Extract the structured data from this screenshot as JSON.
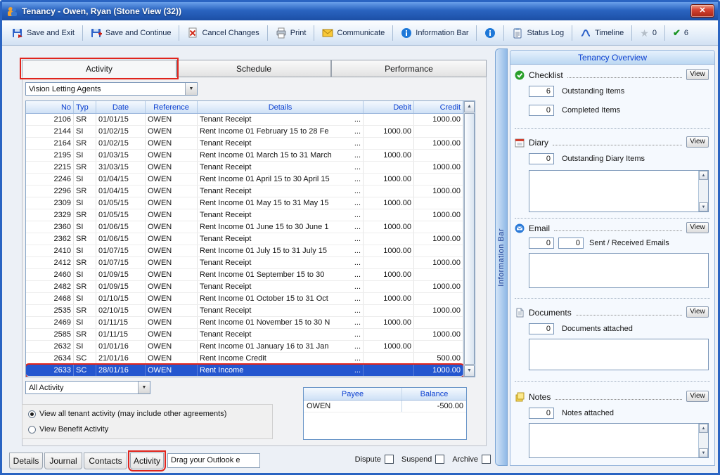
{
  "window": {
    "title": "Tenancy - Owen, Ryan (Stone View (32))"
  },
  "colors": {
    "annotation_red": "#e0241c",
    "selection_blue": "#2456cf",
    "header_text_blue": "#0a3fd0",
    "titlebar_blue": "#2a64c0"
  },
  "icons": {
    "close": "✕",
    "star": "★",
    "check": "✔",
    "combo_arrow": "▼",
    "scroll_up": "▲",
    "scroll_down": "▼"
  },
  "toolbar": {
    "save_exit": "Save and Exit",
    "save_continue": "Save and Continue",
    "cancel_changes": "Cancel Changes",
    "print": "Print",
    "communicate": "Communicate",
    "information_bar": "Information Bar",
    "status_log": "Status Log",
    "timeline": "Timeline",
    "star_count": "0",
    "check_count": "6"
  },
  "tabs": {
    "activity": "Activity",
    "schedule": "Schedule",
    "performance": "Performance"
  },
  "agent_dropdown": {
    "value": "Vision Letting Agents"
  },
  "activity_table": {
    "headers": [
      "No",
      "Typ",
      "Date",
      "Reference",
      "Details",
      "Debit",
      "Credit"
    ],
    "rows": [
      {
        "no": "2106",
        "typ": "SR",
        "date": "01/01/15",
        "ref": "OWEN",
        "details": "Tenant Receipt",
        "debit": "",
        "credit": "1000.00"
      },
      {
        "no": "2144",
        "typ": "SI",
        "date": "01/02/15",
        "ref": "OWEN",
        "details": "Rent Income 01 February 15 to 28 Fe",
        "debit": "1000.00",
        "credit": ""
      },
      {
        "no": "2164",
        "typ": "SR",
        "date": "01/02/15",
        "ref": "OWEN",
        "details": "Tenant Receipt",
        "debit": "",
        "credit": "1000.00"
      },
      {
        "no": "2195",
        "typ": "SI",
        "date": "01/03/15",
        "ref": "OWEN",
        "details": "Rent Income 01 March 15 to 31 March",
        "debit": "1000.00",
        "credit": ""
      },
      {
        "no": "2215",
        "typ": "SR",
        "date": "31/03/15",
        "ref": "OWEN",
        "details": "Tenant Receipt",
        "debit": "",
        "credit": "1000.00"
      },
      {
        "no": "2246",
        "typ": "SI",
        "date": "01/04/15",
        "ref": "OWEN",
        "details": "Rent Income 01 April 15 to 30 April 15",
        "debit": "1000.00",
        "credit": ""
      },
      {
        "no": "2296",
        "typ": "SR",
        "date": "01/04/15",
        "ref": "OWEN",
        "details": "Tenant Receipt",
        "debit": "",
        "credit": "1000.00"
      },
      {
        "no": "2309",
        "typ": "SI",
        "date": "01/05/15",
        "ref": "OWEN",
        "details": "Rent Income 01 May 15 to 31 May 15",
        "debit": "1000.00",
        "credit": ""
      },
      {
        "no": "2329",
        "typ": "SR",
        "date": "01/05/15",
        "ref": "OWEN",
        "details": "Tenant Receipt",
        "debit": "",
        "credit": "1000.00"
      },
      {
        "no": "2360",
        "typ": "SI",
        "date": "01/06/15",
        "ref": "OWEN",
        "details": "Rent Income 01 June 15 to 30 June 1",
        "debit": "1000.00",
        "credit": ""
      },
      {
        "no": "2362",
        "typ": "SR",
        "date": "01/06/15",
        "ref": "OWEN",
        "details": "Tenant Receipt",
        "debit": "",
        "credit": "1000.00"
      },
      {
        "no": "2410",
        "typ": "SI",
        "date": "01/07/15",
        "ref": "OWEN",
        "details": "Rent Income 01 July 15 to 31 July 15",
        "debit": "1000.00",
        "credit": ""
      },
      {
        "no": "2412",
        "typ": "SR",
        "date": "01/07/15",
        "ref": "OWEN",
        "details": "Tenant Receipt",
        "debit": "",
        "credit": "1000.00"
      },
      {
        "no": "2460",
        "typ": "SI",
        "date": "01/09/15",
        "ref": "OWEN",
        "details": "Rent Income 01 September 15 to 30",
        "debit": "1000.00",
        "credit": ""
      },
      {
        "no": "2482",
        "typ": "SR",
        "date": "01/09/15",
        "ref": "OWEN",
        "details": "Tenant Receipt",
        "debit": "",
        "credit": "1000.00"
      },
      {
        "no": "2468",
        "typ": "SI",
        "date": "01/10/15",
        "ref": "OWEN",
        "details": "Rent Income 01 October 15 to 31 Oct",
        "debit": "1000.00",
        "credit": ""
      },
      {
        "no": "2535",
        "typ": "SR",
        "date": "02/10/15",
        "ref": "OWEN",
        "details": "Tenant Receipt",
        "debit": "",
        "credit": "1000.00"
      },
      {
        "no": "2469",
        "typ": "SI",
        "date": "01/11/15",
        "ref": "OWEN",
        "details": "Rent Income 01 November 15 to 30 N",
        "debit": "1000.00",
        "credit": ""
      },
      {
        "no": "2585",
        "typ": "SR",
        "date": "01/11/15",
        "ref": "OWEN",
        "details": "Tenant Receipt",
        "debit": "",
        "credit": "1000.00"
      },
      {
        "no": "2632",
        "typ": "SI",
        "date": "01/01/16",
        "ref": "OWEN",
        "details": "Rent Income 01 January 16 to 31 Jan",
        "debit": "1000.00",
        "credit": ""
      },
      {
        "no": "2634",
        "typ": "SC",
        "date": "21/01/16",
        "ref": "OWEN",
        "details": "Rent Income  Credit",
        "debit": "",
        "credit": "500.00"
      },
      {
        "no": "2633",
        "typ": "SC",
        "date": "28/01/16",
        "ref": "OWEN",
        "details": "Rent Income",
        "debit": "",
        "credit": "1000.00",
        "selected": true
      }
    ]
  },
  "filter_dropdown": {
    "value": "All Activity"
  },
  "view_options": {
    "all_label": "View all tenant activity (may include other agreements)",
    "benefit_label": "View Benefit Activity",
    "selected": "all"
  },
  "payee_table": {
    "headers": [
      "Payee",
      "Balance"
    ],
    "row": {
      "payee": "OWEN",
      "balance": "-500.00"
    }
  },
  "bottom_tabs": {
    "details": "Details",
    "journal": "Journal",
    "contacts": "Contacts",
    "activity": "Activity"
  },
  "outlook_drop": "Drag your Outlook e",
  "flags": {
    "dispute": "Dispute",
    "suspend": "Suspend",
    "archive": "Archive"
  },
  "sidebar": {
    "vertical_label": "Information Bar",
    "title": "Tenancy Overview",
    "view_label": "View",
    "checklist": {
      "label": "Checklist",
      "outstanding": "6",
      "outstanding_label": "Outstanding Items",
      "completed": "0",
      "completed_label": "Completed Items"
    },
    "diary": {
      "label": "Diary",
      "count": "0",
      "count_label": "Outstanding Diary Items"
    },
    "email": {
      "label": "Email",
      "sent": "0",
      "received": "0",
      "count_label": "Sent / Received Emails"
    },
    "documents": {
      "label": "Documents",
      "count": "0",
      "count_label": "Documents attached"
    },
    "notes": {
      "label": "Notes",
      "count": "0",
      "count_label": "Notes attached"
    }
  }
}
